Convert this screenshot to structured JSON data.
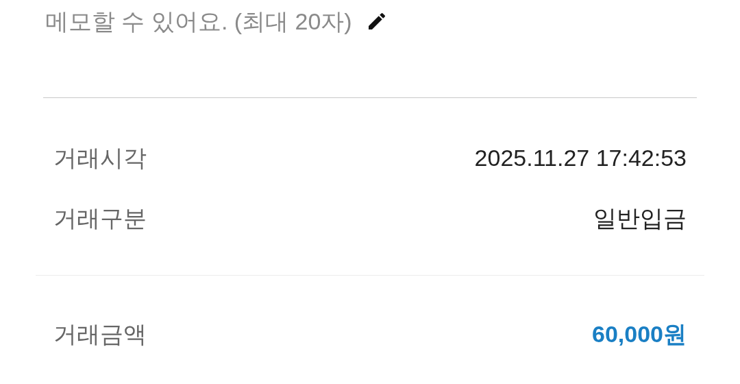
{
  "memo": {
    "text": "메모할 수 있어요. (최대 20자)"
  },
  "sections": [
    {
      "rows": [
        {
          "kind": "plain",
          "label": "거래시각",
          "value": "2025.11.27 17:42:53"
        },
        {
          "kind": "plain",
          "label": "거래구분",
          "value": "일반입금"
        }
      ]
    },
    {
      "rows": [
        {
          "kind": "amount",
          "label": "거래금액",
          "value": "60,000원"
        }
      ]
    }
  ]
}
